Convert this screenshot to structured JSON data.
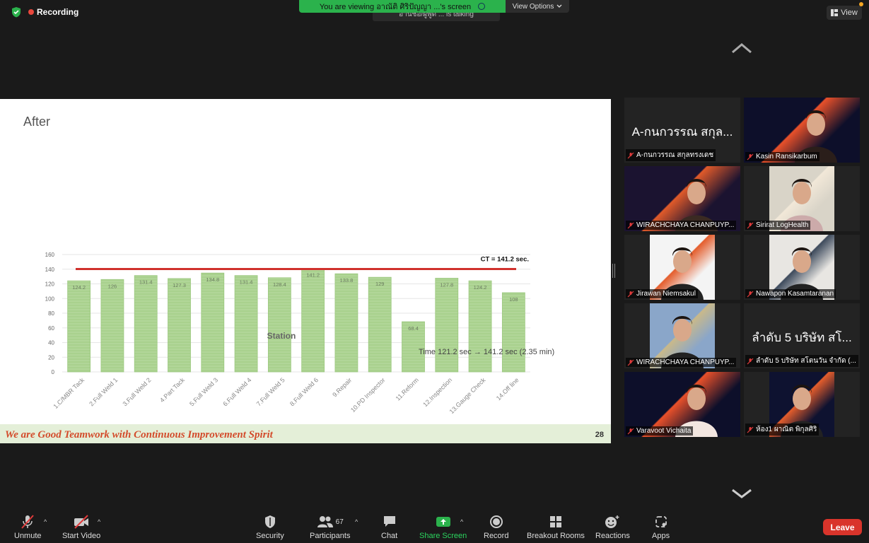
{
  "top": {
    "recording_label": "Recording",
    "talking_text": "อ่านชื่อ/ผู้พูด ... is talking",
    "viewing_text": "You are viewing อาณัติ ศิริปัญญา ...'s screen",
    "view_options_label": "View Options",
    "view_label": "View"
  },
  "slide": {
    "title": "After",
    "time_note": "Time 121.2 sec → 141.2 sec (2.35 min)",
    "footer": "We are Good Teamwork with Continuous Improvement Spirit",
    "page_number": "28"
  },
  "chart_data": {
    "type": "bar",
    "categories": [
      "1.C/MBR Tack",
      "2.Full Weld 1",
      "3.Full Weld 2",
      "4.Part Tack",
      "5.Full Weld 3",
      "6.Full Weld 4",
      "7.Full Weld 5",
      "8.Full Weld 6",
      "9.Repair",
      "10.PD Inspector",
      "11.Reform",
      "12.Inspection",
      "13.Gauge Check",
      "14.Off line"
    ],
    "values": [
      124.2,
      126,
      131.4,
      127.3,
      134.8,
      131.4,
      128.4,
      141.2,
      133.8,
      129,
      68.4,
      127.8,
      124.2,
      108
    ],
    "value_labels": [
      "124.2",
      "126",
      "131.4",
      "127.3",
      "134.8",
      "131.4",
      "128.4",
      "141.2",
      "133.8",
      "129",
      "68.4",
      "127.8",
      "124.2",
      "108"
    ],
    "y_ticks": [
      "0",
      "20",
      "40",
      "60",
      "80",
      "100",
      "120",
      "140",
      "160"
    ],
    "ylim": [
      0,
      160
    ],
    "xlabel": "Station",
    "ylabel": "",
    "reference_line": {
      "value": 141.2,
      "label": "CT = 141.2 sec.",
      "color": "#d0312d"
    },
    "bar_color": "#a9d18e",
    "grid": true
  },
  "gallery": [
    {
      "name": "A-กนกวรรณ สกุลทรงเดช",
      "big_name": "A-กนกวรรณ สกุล...",
      "video": false
    },
    {
      "name": "Kasin Ransikarbum",
      "video": true
    },
    {
      "name": "WIRACHCHAYA CHANPUYP...",
      "video": true
    },
    {
      "name": "Sirirat LogHealth",
      "video": true
    },
    {
      "name": "Jirawan Niemsakul",
      "video": true
    },
    {
      "name": "Nawapon Kasamtaranan",
      "video": true
    },
    {
      "name": "WIRACHCHAYA CHANPUYP...",
      "video": true
    },
    {
      "name": "ลำดับ 5 บริษัท สโตนวัน จำกัด (...",
      "big_name": "ลำดับ 5 บริษัท สโ...",
      "video": false
    },
    {
      "name": "Varavoot Vichaita",
      "video": true
    },
    {
      "name": "ห้อง1 ผาณิต พิกุลศิริ",
      "video": true
    }
  ],
  "toolbar": {
    "unmute": "Unmute",
    "start_video": "Start Video",
    "security": "Security",
    "participants": "Participants",
    "participants_count": "67",
    "chat": "Chat",
    "share_screen": "Share Screen",
    "record": "Record",
    "breakout_rooms": "Breakout Rooms",
    "reactions": "Reactions",
    "apps": "Apps",
    "leave": "Leave"
  }
}
